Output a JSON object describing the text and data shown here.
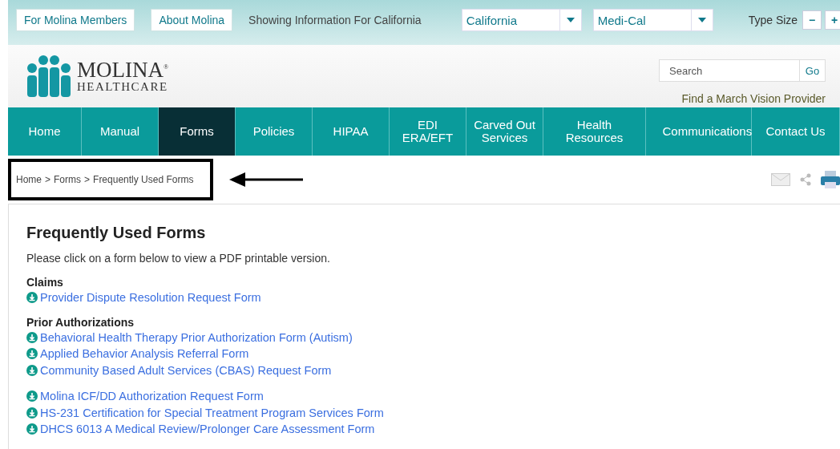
{
  "top_bar": {
    "links": [
      "For Molina Members",
      "About Molina"
    ],
    "info": "Showing Information For California",
    "selects": [
      {
        "value": "California"
      },
      {
        "value": "Medi-Cal"
      }
    ],
    "type_size": {
      "label": "Type Size",
      "buttons": [
        "−",
        "+"
      ]
    }
  },
  "header": {
    "logo": {
      "name": "MOLINA",
      "mark": "®",
      "sub": "HEALTHCARE"
    },
    "search": {
      "placeholder": "Search",
      "button": "Go"
    },
    "vision_link": "Find a March Vision Provider"
  },
  "nav": [
    {
      "label": "Home",
      "selected": false
    },
    {
      "label": "Manual",
      "selected": false
    },
    {
      "label": "Forms",
      "selected": true
    },
    {
      "label": "Policies",
      "selected": false
    },
    {
      "label": "HIPAA",
      "selected": false
    },
    {
      "label": "EDI ERA/EFT",
      "selected": false
    },
    {
      "label": "Carved Out Services",
      "selected": false
    },
    {
      "label": "Health Resources",
      "selected": false
    },
    {
      "label": "Communications",
      "selected": false
    },
    {
      "label": "Contact Us",
      "selected": false
    }
  ],
  "breadcrumb": {
    "separator": ">",
    "items": [
      "Home",
      "Forms",
      "Frequently Used Forms"
    ]
  },
  "content": {
    "title": "Frequently Used Forms",
    "intro": "Please click on a form below to view a PDF printable version.",
    "groups": [
      {
        "heading": "Claims",
        "forms": [
          "Provider Dispute Resolution Request Form"
        ]
      },
      {
        "heading": "Prior Authorizations",
        "forms": [
          "Behavioral Health Therapy Prior Authorization Form (Autism)",
          "Applied Behavior Analysis Referral Form",
          "Community Based Adult Services (CBAS) Request Form"
        ]
      },
      {
        "forms": [
          "Molina ICF/DD Authorization Request Form",
          "HS-231 Certification for Special Treatment Program Services Form",
          "DHCS 6013 A Medical Review/Prolonger Care Assessment Form"
        ]
      }
    ]
  }
}
